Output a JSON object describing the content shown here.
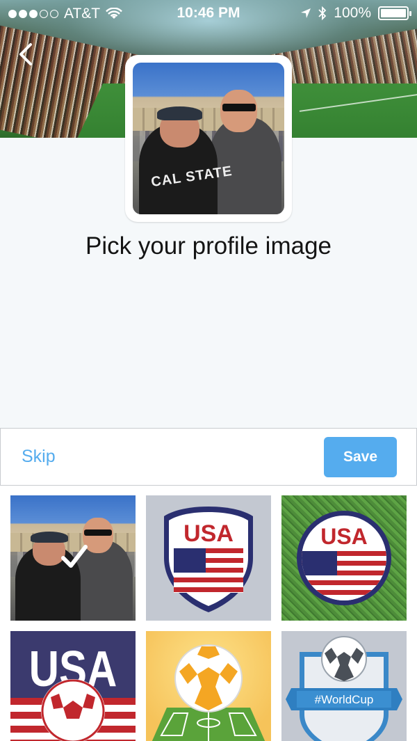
{
  "status_bar": {
    "carrier": "AT&T",
    "time": "10:46 PM",
    "battery": "100%"
  },
  "header": {
    "title": "Pick your profile image"
  },
  "profile_photo": {
    "shirt_text": "CAL STATE"
  },
  "actions": {
    "skip_label": "Skip",
    "save_label": "Save"
  },
  "image_grid": {
    "usa_text": "USA",
    "worldcup_text": "#WorldCup",
    "selected_index": 0
  },
  "colors": {
    "accent": "#55acee",
    "background": "#f5f8fa"
  }
}
